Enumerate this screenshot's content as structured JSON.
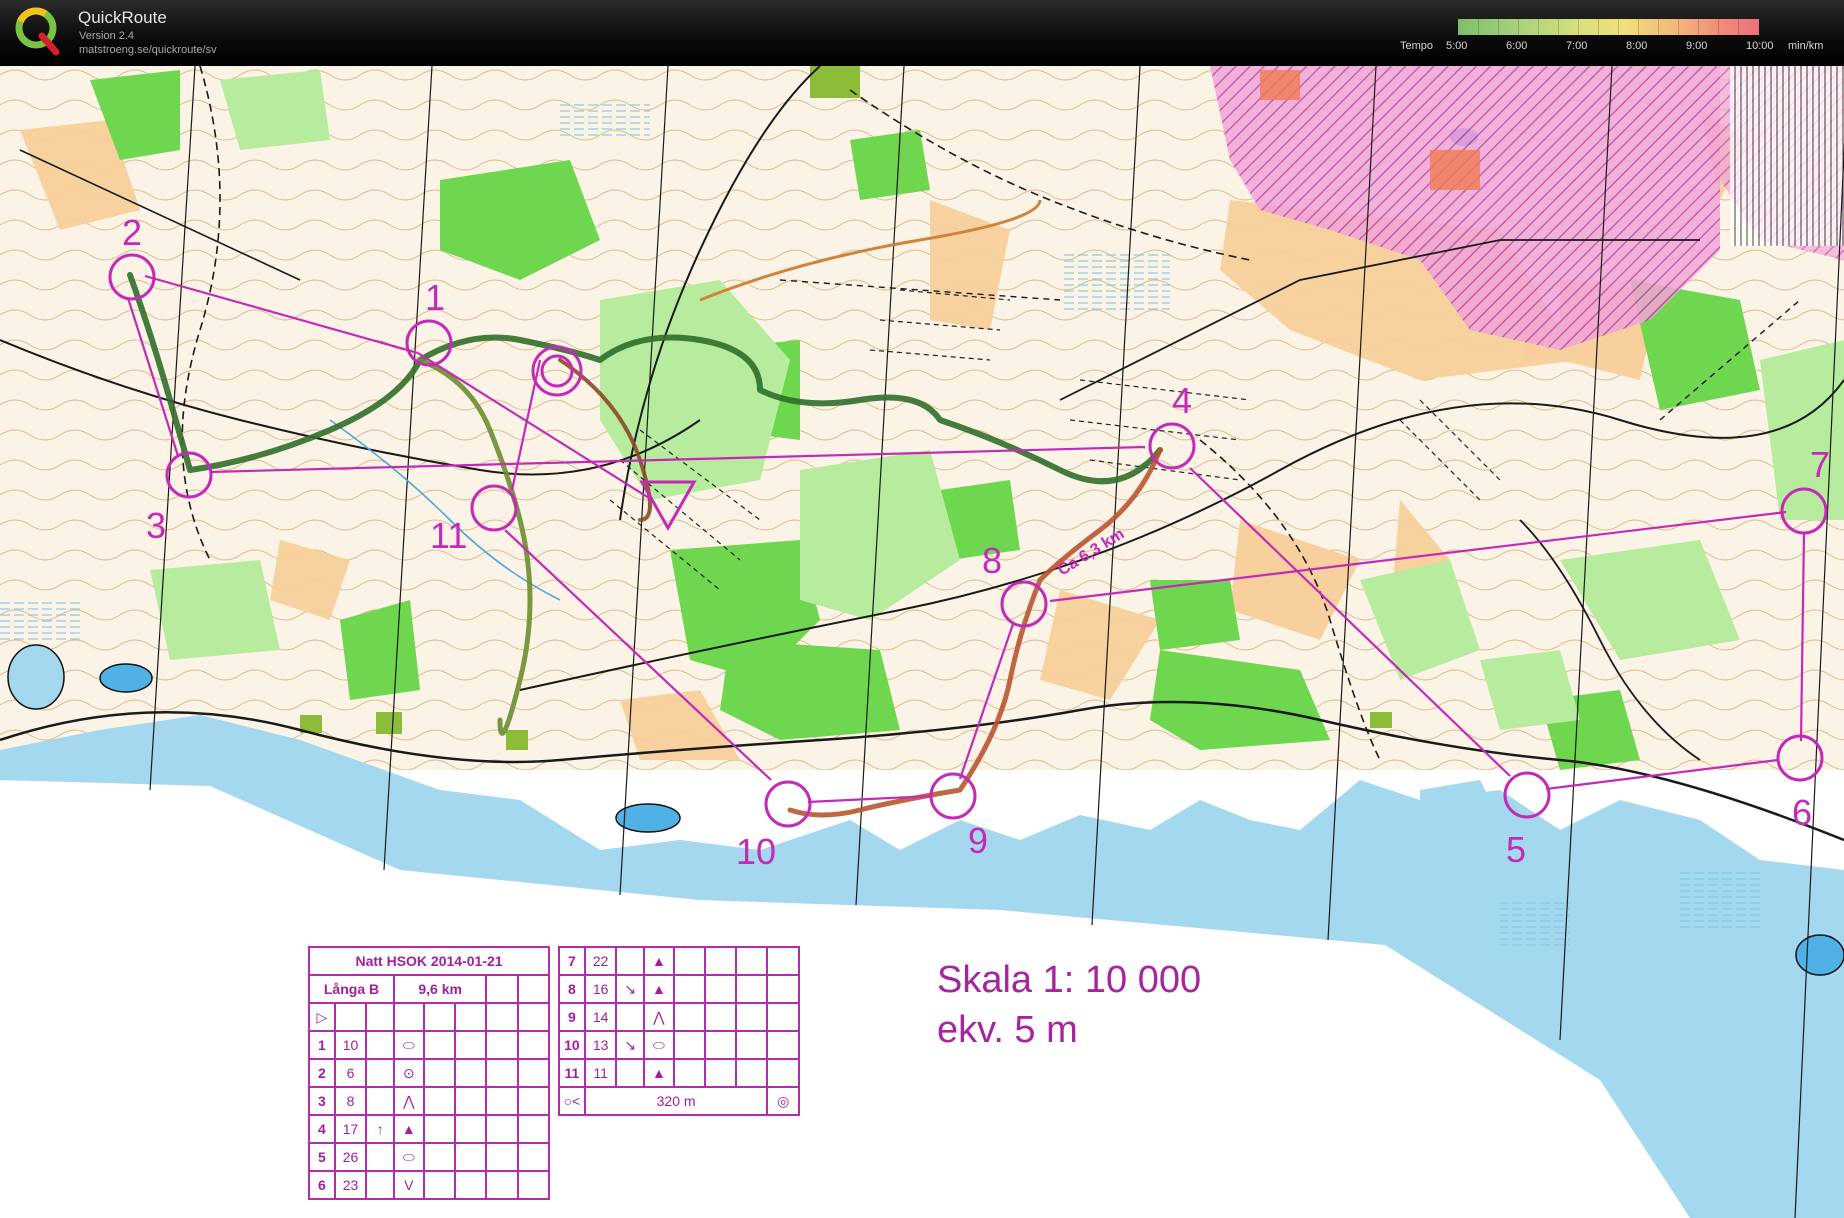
{
  "app": {
    "name": "QuickRoute",
    "version": "Version 2.4",
    "url": "matstroeng.se/quickroute/sv",
    "logo_letter": "Q"
  },
  "tempo": {
    "label": "Tempo",
    "ticks": [
      "5:00",
      "6:00",
      "7:00",
      "8:00",
      "9:00",
      "10:00"
    ],
    "unit": "min/km"
  },
  "map": {
    "distance_label": "Ca 6,3 km",
    "scale_line1": "Skala 1: 10 000",
    "scale_line2": "ekv. 5 m",
    "controls": [
      {
        "num": "1"
      },
      {
        "num": "2"
      },
      {
        "num": "3"
      },
      {
        "num": "4"
      },
      {
        "num": "5"
      },
      {
        "num": "6"
      },
      {
        "num": "7"
      },
      {
        "num": "8"
      },
      {
        "num": "9"
      },
      {
        "num": "10"
      },
      {
        "num": "11"
      }
    ]
  },
  "control_description": {
    "title": "Natt HSOK 2014-01-21",
    "course": "Långa B",
    "length": "9,6 km",
    "rows_left": [
      {
        "num": "1",
        "code": "10",
        "dir": "",
        "sym": "⬭"
      },
      {
        "num": "2",
        "code": "6",
        "dir": "",
        "sym": "⊙"
      },
      {
        "num": "3",
        "code": "8",
        "dir": "",
        "sym": "⋀"
      },
      {
        "num": "4",
        "code": "17",
        "dir": "↑",
        "sym": "▲"
      },
      {
        "num": "5",
        "code": "26",
        "dir": "",
        "sym": "⬭"
      },
      {
        "num": "6",
        "code": "23",
        "dir": "",
        "sym": "V"
      }
    ],
    "rows_right": [
      {
        "num": "7",
        "code": "22",
        "dir": "",
        "sym": "▲"
      },
      {
        "num": "8",
        "code": "16",
        "dir": "↘",
        "sym": "▲"
      },
      {
        "num": "9",
        "code": "14",
        "dir": "",
        "sym": "⋀"
      },
      {
        "num": "10",
        "code": "13",
        "dir": "↘",
        "sym": "⬭"
      },
      {
        "num": "11",
        "code": "11",
        "dir": "",
        "sym": "▲"
      }
    ],
    "finish_distance": "320 m"
  },
  "colors": {
    "course": "#c42ab8",
    "water": "#a3d8ee",
    "green": "#6fd64f",
    "open": "#f7cf9a",
    "route": "#3f7a3a"
  }
}
